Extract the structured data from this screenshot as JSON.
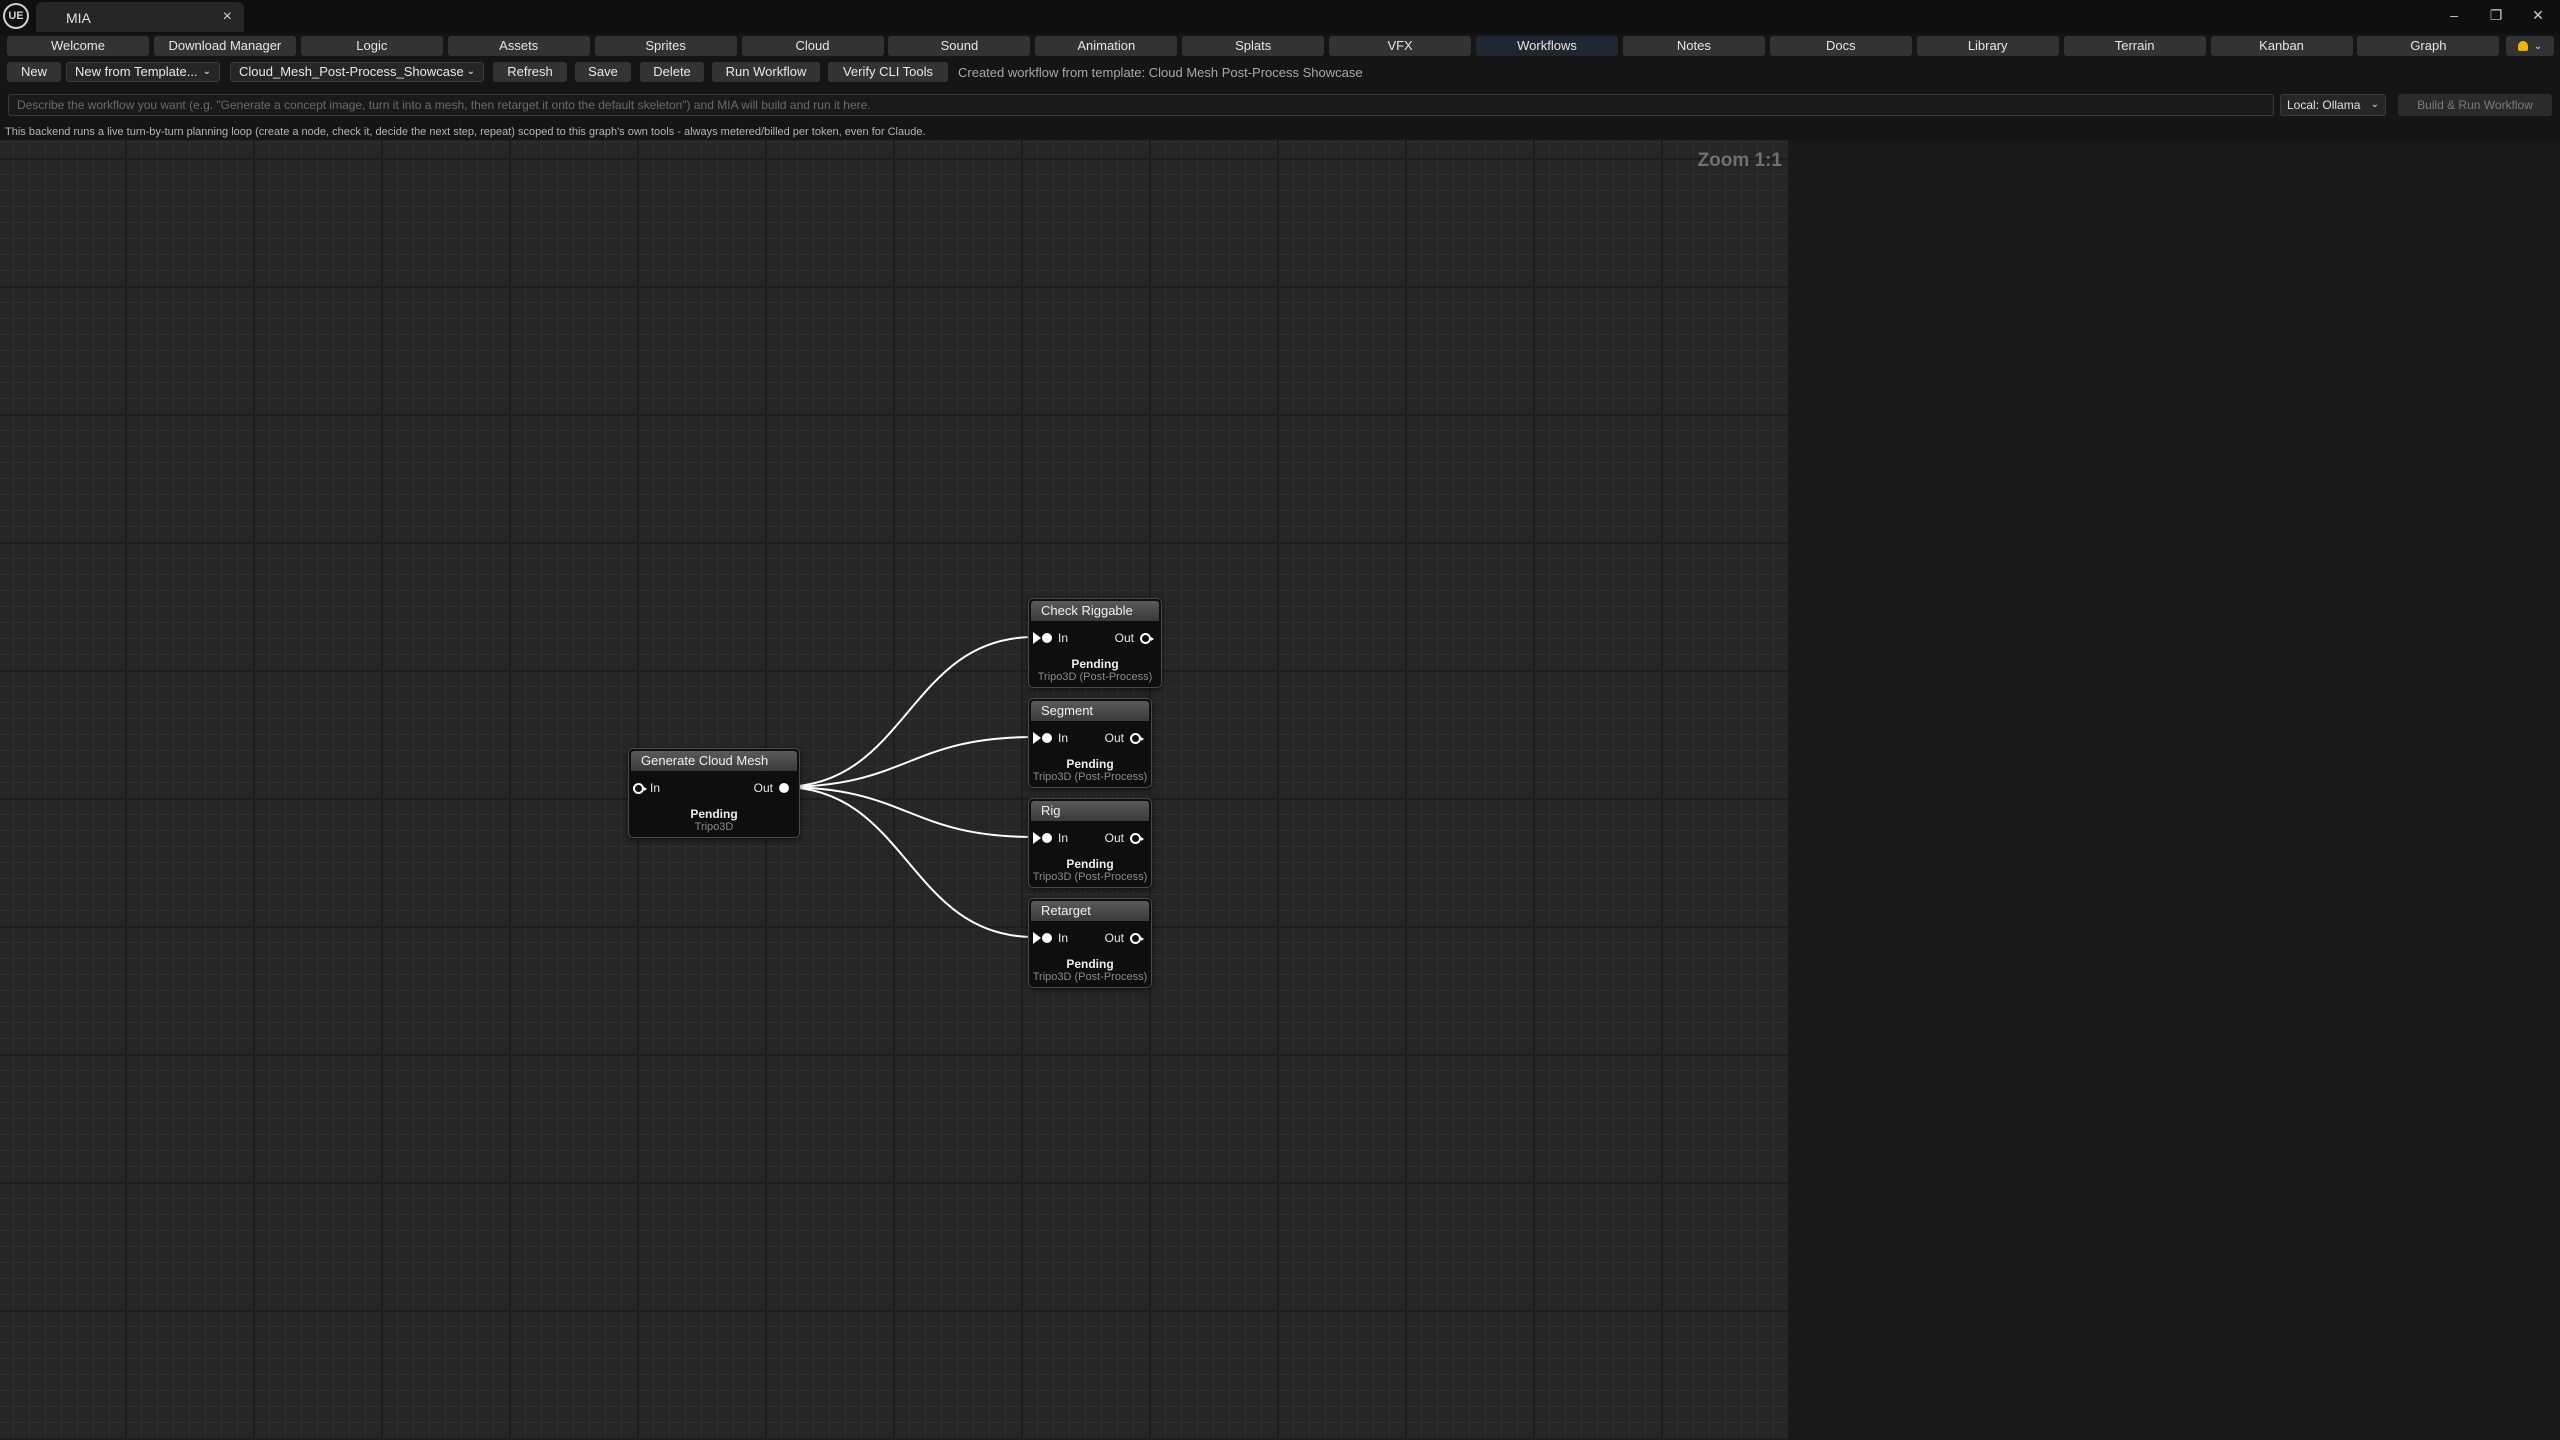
{
  "app": {
    "logo_text": "UE",
    "tab_title": "MIA",
    "close_glyph": "×"
  },
  "window_controls": {
    "minimize": "–",
    "restore": "❐",
    "close": "✕"
  },
  "module_tabs": [
    {
      "label": "Welcome"
    },
    {
      "label": "Download Manager"
    },
    {
      "label": "Logic"
    },
    {
      "label": "Assets"
    },
    {
      "label": "Sprites"
    },
    {
      "label": "Cloud"
    },
    {
      "label": "Sound"
    },
    {
      "label": "Animation"
    },
    {
      "label": "Splats"
    },
    {
      "label": "VFX"
    },
    {
      "label": "Workflows",
      "active": true
    },
    {
      "label": "Notes"
    },
    {
      "label": "Docs"
    },
    {
      "label": "Library"
    },
    {
      "label": "Terrain"
    },
    {
      "label": "Kanban"
    },
    {
      "label": "Graph"
    }
  ],
  "notifications": {
    "icon": "bell-icon",
    "chevron": "⌄"
  },
  "toolbar": {
    "new_label": "New",
    "template_dropdown": "New from Template...",
    "workflow_dropdown": "Cloud_Mesh_Post-Process_Showcase",
    "refresh_label": "Refresh",
    "save_label": "Save",
    "delete_label": "Delete",
    "run_label": "Run Workflow",
    "verify_label": "Verify CLI Tools",
    "status": "Created workflow from template: Cloud Mesh Post-Process Showcase",
    "dropdown_chevron": "⌄"
  },
  "prompt": {
    "placeholder": "Describe the workflow you want (e.g. \"Generate a concept image, turn it into a mesh, then retarget it onto the default skeleton\") and MIA will build and run it here.",
    "backend": "Local: Ollama",
    "build_label": "Build & Run Workflow",
    "info": "This backend runs a live turn-by-turn planning loop (create a node, check it, decide the next step, repeat) scoped to this graph's own tools - always metered/billed per token, even for Claude."
  },
  "canvas": {
    "zoom": "Zoom 1:1"
  },
  "nodes": [
    {
      "title": "Generate Cloud Mesh",
      "in": "In",
      "out": "Out",
      "state": "Pending",
      "type": "Tripo3D"
    },
    {
      "title": "Check Riggable",
      "in": "In",
      "out": "Out",
      "state": "Pending",
      "type": "Tripo3D (Post-Process)"
    },
    {
      "title": "Segment",
      "in": "In",
      "out": "Out",
      "state": "Pending",
      "type": "Tripo3D (Post-Process)"
    },
    {
      "title": "Rig",
      "in": "In",
      "out": "Out",
      "state": "Pending",
      "type": "Tripo3D (Post-Process)"
    },
    {
      "title": "Retarget",
      "in": "In",
      "out": "Out",
      "state": "Pending",
      "type": "Tripo3D (Post-Process)"
    }
  ],
  "colors": {
    "accent_tab": "#1f2733",
    "bell": "#f0b400",
    "wire": "#ffffff"
  }
}
